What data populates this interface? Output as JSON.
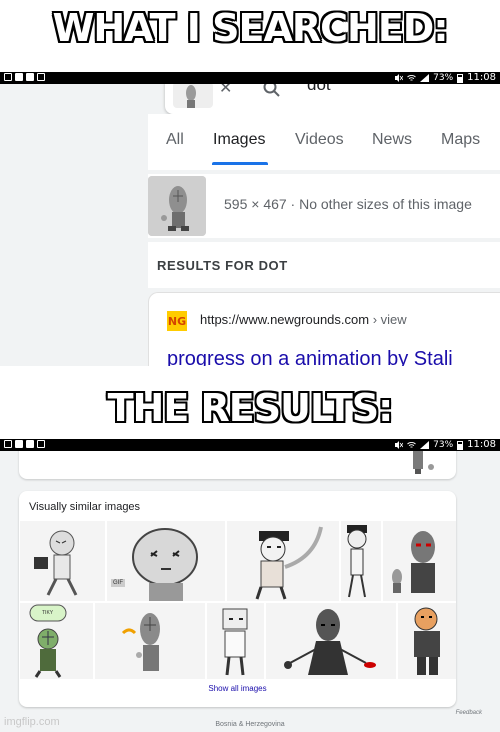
{
  "captions": {
    "top": "WHAT I SEARCHED:",
    "bottom": "THE RESULTS:"
  },
  "status_bar": {
    "battery": "73%",
    "time": "11:08"
  },
  "search": {
    "query": "dot",
    "clear_icon": "close-icon",
    "search_icon": "search-icon",
    "tabs": [
      "All",
      "Images",
      "Videos",
      "News",
      "Maps"
    ],
    "active_tab": "Images",
    "image_meta": "595 × 467 · No other sizes of this image",
    "results_header": "RESULTS FOR DOT",
    "result": {
      "site_logo": "NG",
      "url": "https://www.newgrounds.com",
      "url_path": "› view",
      "title": "progress on a animation by Stali"
    }
  },
  "results_page": {
    "section_title": "Visually similar images",
    "gif_badge": "GIF",
    "tiny_label": "TIKY",
    "show_all": "Show all images",
    "feedback": "Feedback",
    "footer": "Bosnia & Herzegovina"
  },
  "watermark": "imgflip.com",
  "colors": {
    "accent_blue": "#1a73e8",
    "link_blue": "#1a0dab",
    "background_gray": "#f1f3f4"
  }
}
